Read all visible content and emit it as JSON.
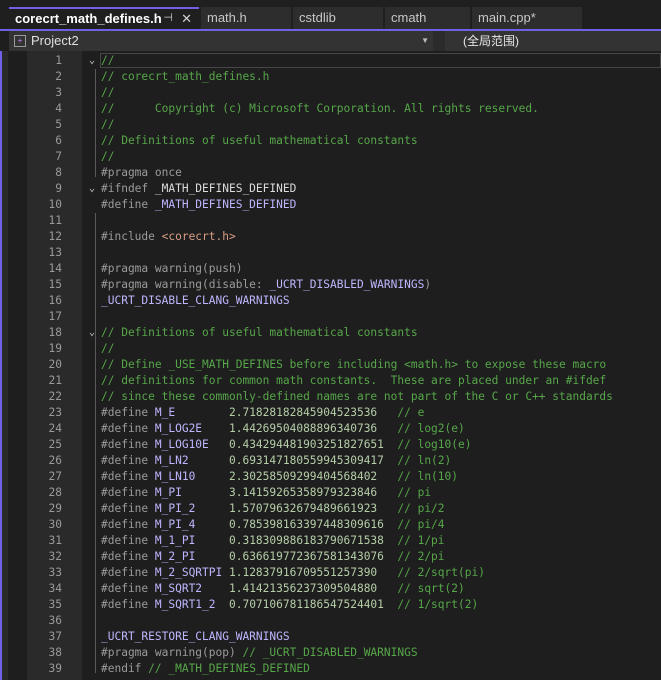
{
  "tabs": [
    {
      "label": "corecrt_math_defines.h",
      "active": true,
      "pin_icon": "pin-icon",
      "close_icon": "close-icon"
    },
    {
      "label": "math.h"
    },
    {
      "label": "cstdlib"
    },
    {
      "label": "cmath"
    },
    {
      "label": "main.cpp*"
    }
  ],
  "navbar": {
    "project": "Project2",
    "scope": "(全局范围)"
  },
  "colors": {
    "accent": "#7160e8",
    "comment": "#57a64a",
    "preprocessor": "#9b9b9b",
    "macro": "#beb7ff",
    "string": "#d69d85",
    "number": "#b5cea8",
    "background": "#1e1e1e"
  },
  "lines": [
    {
      "n": "1",
      "fold": "v",
      "parts": [
        [
          "c-com",
          "//"
        ]
      ]
    },
    {
      "n": "2",
      "parts": [
        [
          "c-com",
          "// corecrt_math_defines.h"
        ]
      ]
    },
    {
      "n": "3",
      "parts": [
        [
          "c-com",
          "//"
        ]
      ]
    },
    {
      "n": "4",
      "parts": [
        [
          "c-com",
          "//      Copyright (c) Microsoft Corporation. All rights reserved."
        ]
      ]
    },
    {
      "n": "5",
      "parts": [
        [
          "c-com",
          "//"
        ]
      ]
    },
    {
      "n": "6",
      "parts": [
        [
          "c-com",
          "// Definitions of useful mathematical constants"
        ]
      ]
    },
    {
      "n": "7",
      "parts": [
        [
          "c-com",
          "//"
        ]
      ]
    },
    {
      "n": "8",
      "parts": [
        [
          "c-pp",
          "#pragma once"
        ]
      ]
    },
    {
      "n": "9",
      "fold": "v",
      "parts": [
        [
          "c-pp",
          "#ifndef "
        ],
        [
          "c-id",
          "_MATH_DEFINES_DEFINED"
        ]
      ]
    },
    {
      "n": "10",
      "parts": [
        [
          "c-pp",
          "#define "
        ],
        [
          "c-mac",
          "_MATH_DEFINES_DEFINED"
        ]
      ]
    },
    {
      "n": "11",
      "parts": []
    },
    {
      "n": "12",
      "parts": [
        [
          "c-pp",
          "#include "
        ],
        [
          "c-str",
          "<corecrt.h>"
        ]
      ]
    },
    {
      "n": "13",
      "parts": []
    },
    {
      "n": "14",
      "parts": [
        [
          "c-pp",
          "#pragma warning(push)"
        ]
      ]
    },
    {
      "n": "15",
      "parts": [
        [
          "c-pp",
          "#pragma warning(disable: "
        ],
        [
          "c-mac",
          "_UCRT_DISABLED_WARNINGS"
        ],
        [
          "c-pp",
          ")"
        ]
      ]
    },
    {
      "n": "16",
      "parts": [
        [
          "c-mac",
          "_UCRT_DISABLE_CLANG_WARNINGS"
        ]
      ]
    },
    {
      "n": "17",
      "parts": []
    },
    {
      "n": "18",
      "fold": "v",
      "parts": [
        [
          "c-com",
          "// Definitions of useful mathematical constants"
        ]
      ]
    },
    {
      "n": "19",
      "parts": [
        [
          "c-com",
          "//"
        ]
      ]
    },
    {
      "n": "20",
      "parts": [
        [
          "c-com",
          "// Define _USE_MATH_DEFINES before including <math.h> to expose these macro"
        ]
      ]
    },
    {
      "n": "21",
      "parts": [
        [
          "c-com",
          "// definitions for common math constants.  These are placed under an #ifdef"
        ]
      ]
    },
    {
      "n": "22",
      "parts": [
        [
          "c-com",
          "// since these commonly-defined names are not part of the C or C++ standards"
        ]
      ]
    },
    {
      "n": "23",
      "parts": [
        [
          "c-pp",
          "#define "
        ],
        [
          "c-mac",
          "M_E        "
        ],
        [
          "c-num",
          "2.71828182845904523536   "
        ],
        [
          "c-com",
          "// e"
        ]
      ]
    },
    {
      "n": "24",
      "parts": [
        [
          "c-pp",
          "#define "
        ],
        [
          "c-mac",
          "M_LOG2E    "
        ],
        [
          "c-num",
          "1.44269504088896340736   "
        ],
        [
          "c-com",
          "// log2(e)"
        ]
      ]
    },
    {
      "n": "25",
      "parts": [
        [
          "c-pp",
          "#define "
        ],
        [
          "c-mac",
          "M_LOG10E   "
        ],
        [
          "c-num",
          "0.434294481903251827651  "
        ],
        [
          "c-com",
          "// log10(e)"
        ]
      ]
    },
    {
      "n": "26",
      "parts": [
        [
          "c-pp",
          "#define "
        ],
        [
          "c-mac",
          "M_LN2      "
        ],
        [
          "c-num",
          "0.693147180559945309417  "
        ],
        [
          "c-com",
          "// ln(2)"
        ]
      ]
    },
    {
      "n": "27",
      "parts": [
        [
          "c-pp",
          "#define "
        ],
        [
          "c-mac",
          "M_LN10     "
        ],
        [
          "c-num",
          "2.30258509299404568402   "
        ],
        [
          "c-com",
          "// ln(10)"
        ]
      ]
    },
    {
      "n": "28",
      "parts": [
        [
          "c-pp",
          "#define "
        ],
        [
          "c-mac",
          "M_PI       "
        ],
        [
          "c-num",
          "3.14159265358979323846   "
        ],
        [
          "c-com",
          "// pi"
        ]
      ]
    },
    {
      "n": "29",
      "parts": [
        [
          "c-pp",
          "#define "
        ],
        [
          "c-mac",
          "M_PI_2     "
        ],
        [
          "c-num",
          "1.57079632679489661923   "
        ],
        [
          "c-com",
          "// pi/2"
        ]
      ]
    },
    {
      "n": "30",
      "parts": [
        [
          "c-pp",
          "#define "
        ],
        [
          "c-mac",
          "M_PI_4     "
        ],
        [
          "c-num",
          "0.785398163397448309616  "
        ],
        [
          "c-com",
          "// pi/4"
        ]
      ]
    },
    {
      "n": "31",
      "parts": [
        [
          "c-pp",
          "#define "
        ],
        [
          "c-mac",
          "M_1_PI     "
        ],
        [
          "c-num",
          "0.318309886183790671538  "
        ],
        [
          "c-com",
          "// 1/pi"
        ]
      ]
    },
    {
      "n": "32",
      "parts": [
        [
          "c-pp",
          "#define "
        ],
        [
          "c-mac",
          "M_2_PI     "
        ],
        [
          "c-num",
          "0.636619772367581343076  "
        ],
        [
          "c-com",
          "// 2/pi"
        ]
      ]
    },
    {
      "n": "33",
      "parts": [
        [
          "c-pp",
          "#define "
        ],
        [
          "c-mac",
          "M_2_SQRTPI "
        ],
        [
          "c-num",
          "1.12837916709551257390   "
        ],
        [
          "c-com",
          "// 2/sqrt(pi)"
        ]
      ]
    },
    {
      "n": "34",
      "parts": [
        [
          "c-pp",
          "#define "
        ],
        [
          "c-mac",
          "M_SQRT2    "
        ],
        [
          "c-num",
          "1.41421356237309504880   "
        ],
        [
          "c-com",
          "// sqrt(2)"
        ]
      ]
    },
    {
      "n": "35",
      "parts": [
        [
          "c-pp",
          "#define "
        ],
        [
          "c-mac",
          "M_SQRT1_2  "
        ],
        [
          "c-num",
          "0.707106781186547524401  "
        ],
        [
          "c-com",
          "// 1/sqrt(2)"
        ]
      ]
    },
    {
      "n": "36",
      "parts": []
    },
    {
      "n": "37",
      "parts": [
        [
          "c-mac",
          "_UCRT_RESTORE_CLANG_WARNINGS"
        ]
      ]
    },
    {
      "n": "38",
      "parts": [
        [
          "c-pp",
          "#pragma warning(pop) "
        ],
        [
          "c-com",
          "// _UCRT_DISABLED_WARNINGS"
        ]
      ]
    },
    {
      "n": "39",
      "parts": [
        [
          "c-pp",
          "#endif "
        ],
        [
          "c-com",
          "// _MATH_DEFINES_DEFINED"
        ]
      ]
    }
  ]
}
